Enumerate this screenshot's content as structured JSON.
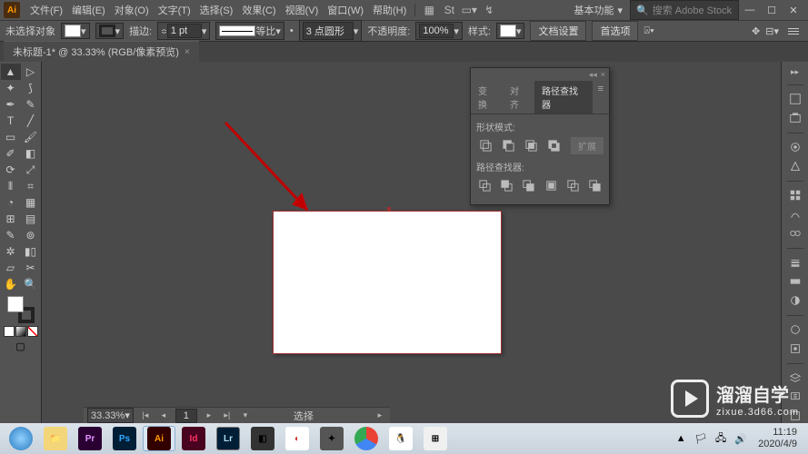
{
  "titlebar": {
    "menus": [
      "文件(F)",
      "编辑(E)",
      "对象(O)",
      "文字(T)",
      "选择(S)",
      "效果(C)",
      "视图(V)",
      "窗口(W)",
      "帮助(H)"
    ],
    "workspace": "基本功能",
    "search_placeholder": "搜索 Adobe Stock"
  },
  "options": {
    "no_selection": "未选择对象",
    "stroke_label": "描边:",
    "stroke_val": "1 pt",
    "uniform": "等比",
    "corner_val": "3 点圆形",
    "opacity_label": "不透明度:",
    "opacity_val": "100%",
    "style_label": "样式:",
    "doc_setup": "文档设置",
    "prefs": "首选项"
  },
  "document": {
    "tab_label": "未标题-1* @ 33.33% (RGB/像素预览)"
  },
  "panel": {
    "tabs": [
      "变换",
      "对齐",
      "路径查找器"
    ],
    "shape_mode": "形状模式:",
    "pathfinder": "路径查找器:",
    "expand": "扩展"
  },
  "status": {
    "zoom": "33.33%",
    "page": "1",
    "tool": "选择"
  },
  "clock": {
    "time": "11:19",
    "date": "2020/4/9"
  },
  "watermark": {
    "brand": "溜溜自学",
    "url": "zixue.3d66.com"
  }
}
